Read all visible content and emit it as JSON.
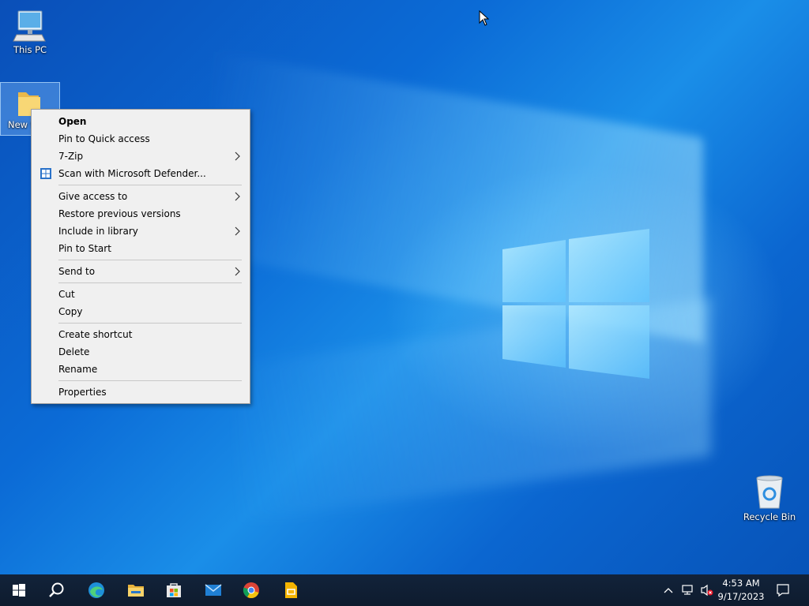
{
  "desktop": {
    "icons": {
      "this_pc": "This PC",
      "new_folder": "New folder",
      "recycle_bin": "Recycle Bin"
    }
  },
  "context_menu": {
    "items": [
      {
        "label": "Open"
      },
      {
        "label": "Pin to Quick access"
      },
      {
        "label": "7-Zip"
      },
      {
        "label": "Scan with Microsoft Defender..."
      },
      {
        "label": "Give access to"
      },
      {
        "label": "Restore previous versions"
      },
      {
        "label": "Include in library"
      },
      {
        "label": "Pin to Start"
      },
      {
        "label": "Send to"
      },
      {
        "label": "Cut"
      },
      {
        "label": "Copy"
      },
      {
        "label": "Create shortcut"
      },
      {
        "label": "Delete"
      },
      {
        "label": "Rename"
      },
      {
        "label": "Properties"
      }
    ]
  },
  "taskbar": {
    "apps": [
      "start-icon",
      "search-icon",
      "edge-icon",
      "file-explorer-icon",
      "store-icon",
      "mail-icon",
      "chrome-icon",
      "slides-icon"
    ],
    "clock": {
      "time": "4:53 AM",
      "date": "9/17/2023"
    }
  },
  "colors": {
    "taskbar": "#0e1b2e",
    "menu_bg": "#f0f0f0",
    "desktop_blue": "#0b6bd6"
  }
}
